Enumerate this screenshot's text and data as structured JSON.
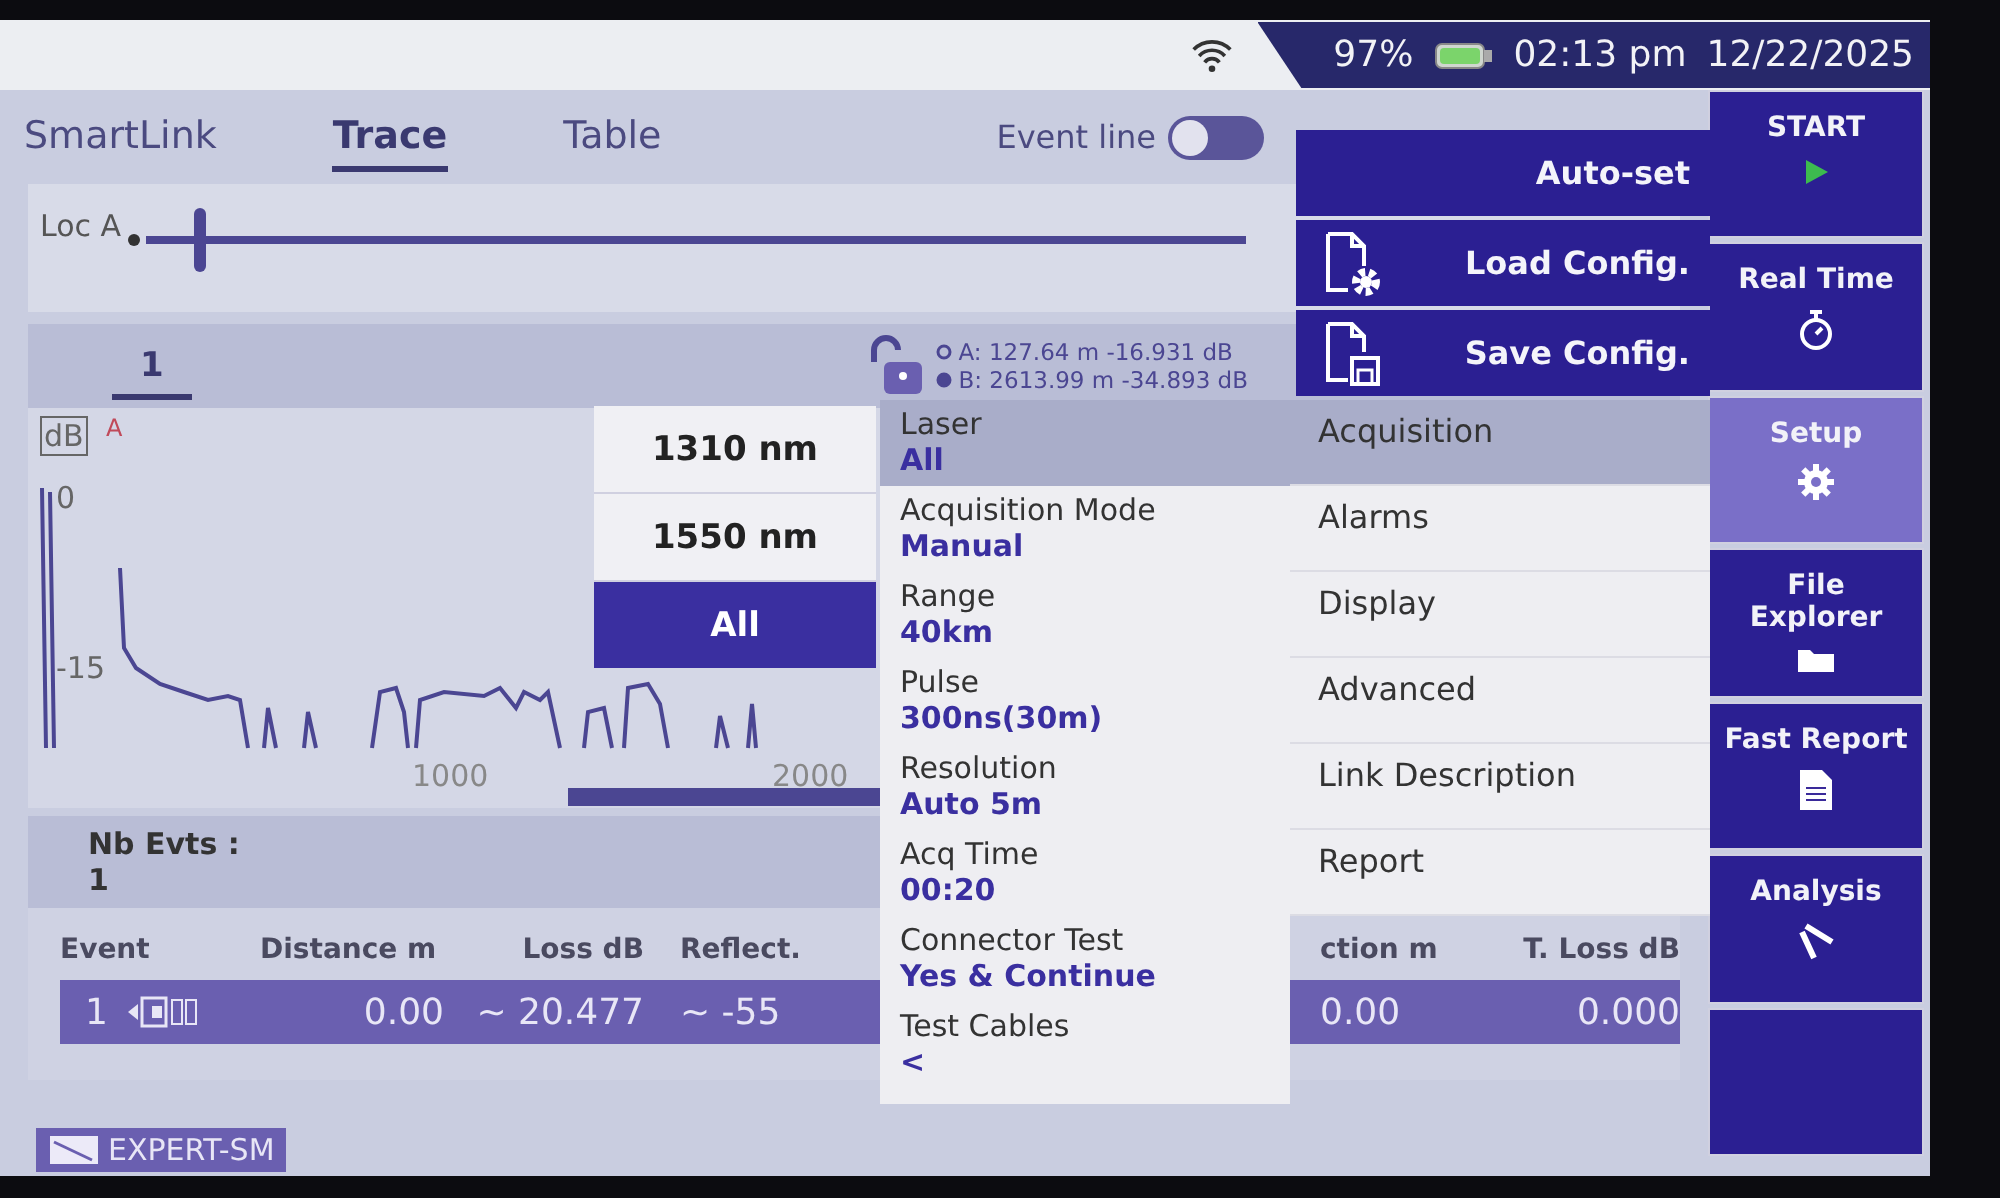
{
  "status_bar": {
    "battery": "97%",
    "time": "02:13 pm",
    "date": "12/22/2025"
  },
  "tabs": [
    {
      "label": "SmartLink",
      "selected": false
    },
    {
      "label": "Trace",
      "selected": true
    },
    {
      "label": "Table",
      "selected": false
    }
  ],
  "event_line": {
    "label": "Event line",
    "on": false
  },
  "link_strip": {
    "label": "Loc A"
  },
  "trace_tabs": [
    {
      "label": "1",
      "selected": true
    }
  ],
  "cursors": [
    {
      "label": "A: 127.64 m -16.931 dB",
      "kind": "hollow"
    },
    {
      "label": "B: 2613.99 m -34.893 dB",
      "kind": "filled"
    }
  ],
  "graph": {
    "unit": "dB",
    "marker": "A",
    "y_labels": [
      "0",
      "-15"
    ],
    "x_labels": [
      "1000",
      "2000"
    ]
  },
  "events": {
    "label": "Nb Evts :",
    "count": "1"
  },
  "event_table": {
    "columns": [
      "Event",
      "Distance  m",
      "Loss dB",
      "Reflect.",
      "ction m",
      "T. Loss dB"
    ],
    "rows": [
      {
        "cells": [
          "1",
          "0.00",
          "~ 20.477",
          "~ -55",
          "0.00",
          "0.000"
        ],
        "selected": true
      }
    ]
  },
  "module": {
    "label": "EXPERT-SM"
  },
  "side_buttons": [
    {
      "label": "START",
      "kind": "start",
      "selected": false
    },
    {
      "label": "Real Time",
      "kind": "realtime",
      "selected": false
    },
    {
      "label": "Setup",
      "kind": "setup",
      "selected": true
    },
    {
      "label": "File Explorer",
      "kind": "files",
      "selected": false
    },
    {
      "label": "Fast Report",
      "kind": "report",
      "selected": false
    },
    {
      "label": "Analysis",
      "kind": "analysis",
      "selected": false
    },
    {
      "kind": "blank",
      "selected": false
    }
  ],
  "config_menu": [
    {
      "label": "Auto-set",
      "kind": "plain"
    },
    {
      "label": "Load Config.",
      "kind": "load"
    },
    {
      "label": "Save Config.",
      "kind": "save"
    }
  ],
  "laser_options": [
    {
      "label": "1310 nm",
      "selected": false
    },
    {
      "label": "1550 nm",
      "selected": false
    },
    {
      "label": "All",
      "selected": true
    }
  ],
  "setup_params": [
    {
      "label": "Laser",
      "value": "All",
      "selected": true
    },
    {
      "label": "Acquisition Mode",
      "value": "Manual",
      "selected": false
    },
    {
      "label": "Range",
      "value": "40km",
      "selected": false
    },
    {
      "label": "Pulse",
      "value": "300ns(30m)",
      "selected": false
    },
    {
      "label": "Resolution",
      "value": "Auto 5m",
      "selected": false
    },
    {
      "label": "Acq Time",
      "value": "00:20",
      "selected": false
    },
    {
      "label": "Connector Test",
      "value": "Yes & Continue",
      "selected": false
    },
    {
      "label": "Test Cables",
      "value": "<",
      "selected": false
    }
  ],
  "setup_categories": [
    {
      "label": "Acquisition",
      "selected": true
    },
    {
      "label": "Alarms",
      "selected": false
    },
    {
      "label": "Display",
      "selected": false
    },
    {
      "label": "Advanced",
      "selected": false
    },
    {
      "label": "Link Description",
      "selected": false
    },
    {
      "label": "Report",
      "selected": false
    }
  ]
}
